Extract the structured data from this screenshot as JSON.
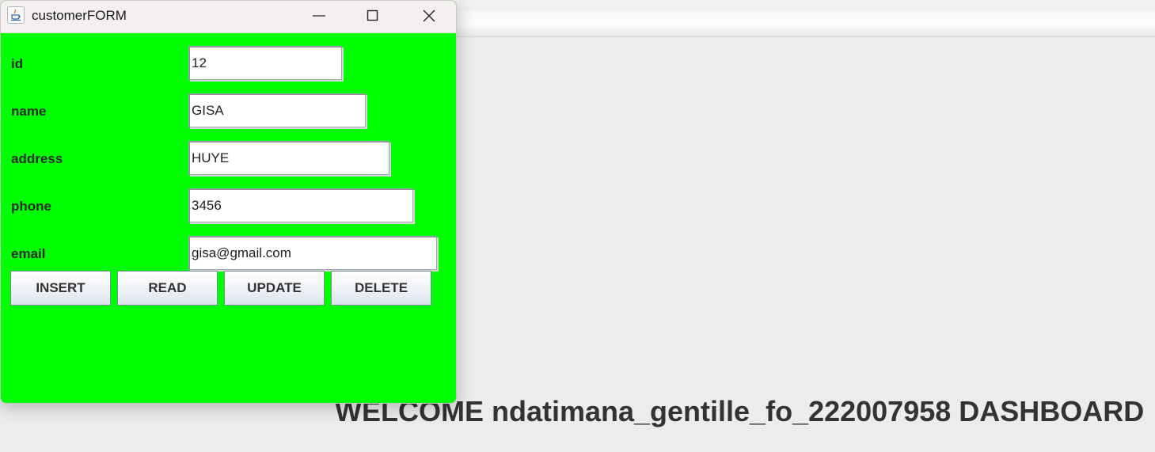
{
  "window": {
    "title": "customerFORM",
    "icon": "java-cup-icon",
    "controls": [
      "minimize-icon",
      "maximize-icon",
      "close-icon"
    ]
  },
  "form": {
    "fields": [
      {
        "label": "id",
        "value": "12"
      },
      {
        "label": "name",
        "value": "GISA"
      },
      {
        "label": "address",
        "value": "HUYE"
      },
      {
        "label": "phone",
        "value": "3456"
      },
      {
        "label": "email",
        "value": "gisa@gmail.com"
      }
    ],
    "buttons": [
      "INSERT",
      "READ",
      "UPDATE",
      "DELETE"
    ],
    "background_color": "#00ff00"
  },
  "dashboard": {
    "welcome": "WELCOME ndatimana_gentille_fo_222007958 DASHBOARD"
  }
}
